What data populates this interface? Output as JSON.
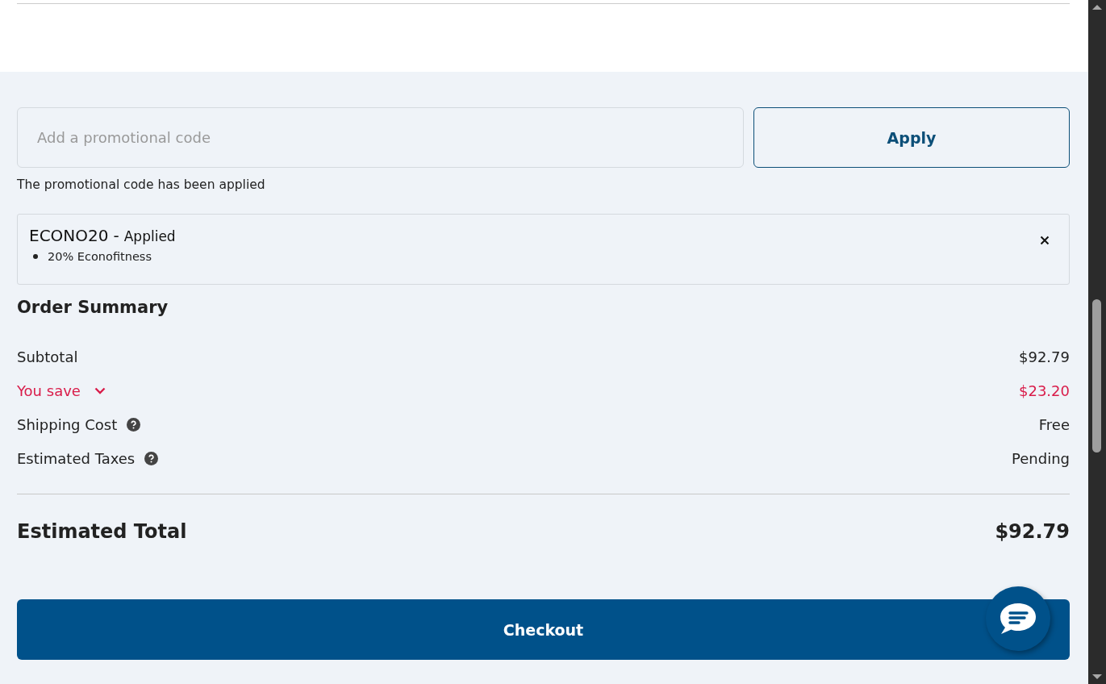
{
  "promo": {
    "placeholder": "Add a promotional code",
    "apply_button": "Apply",
    "message": "The promotional code has been applied"
  },
  "applied_code": {
    "code": "ECONO20",
    "separator": "-",
    "status": "Applied",
    "details": [
      "20% Econofitness"
    ]
  },
  "order_summary": {
    "title": "Order Summary",
    "rows": [
      {
        "kind": "plain",
        "label": "Subtotal",
        "value": "$92.79"
      },
      {
        "kind": "savings",
        "label": "You save",
        "value": "$23.20"
      },
      {
        "kind": "info",
        "label": "Shipping Cost",
        "value": "Free"
      },
      {
        "kind": "info",
        "label": "Estimated Taxes",
        "value": "Pending"
      }
    ],
    "total_label": "Estimated Total",
    "total_value": "$92.79"
  },
  "checkout_button": "Checkout"
}
